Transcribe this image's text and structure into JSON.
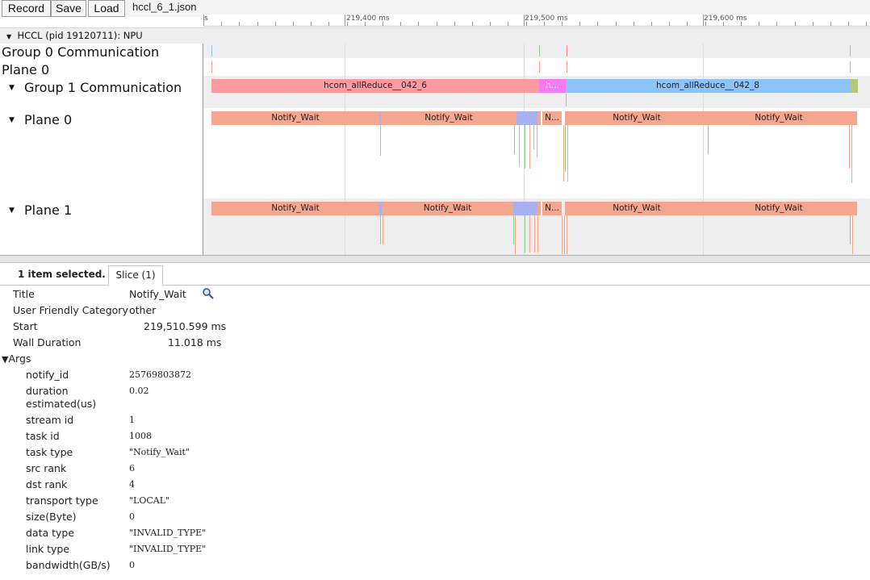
{
  "toolbar": {
    "record_label": "Record",
    "save_label": "Save",
    "load_label": "Load",
    "filename": "hccl_6_1.json"
  },
  "ruler": {
    "left_fragment": "s",
    "ticks": [
      "219,400 ms",
      "219,500 ms",
      "219,600 ms"
    ]
  },
  "process": {
    "label": "HCCL (pid 19120711): NPU"
  },
  "tracks": {
    "group0": "Group 0 Communication",
    "plane0_top": "Plane 0",
    "group1": "Group 1 Communication",
    "plane0": "Plane 0",
    "plane1": "Plane 1"
  },
  "slices": {
    "allreduce6": "hcom_allReduce__042_6",
    "h_short": "h...",
    "allreduce8": "hcom_allReduce__042_8",
    "nw": "Notify_Wait",
    "n_short": "N..."
  },
  "colors": {
    "pink": "#ff9aa2",
    "magenta": "#f77cf2",
    "blue": "#8ec3f7",
    "salmon": "#f5a68f",
    "lavender": "#a8b0f0",
    "olive": "#b5c77a"
  },
  "details": {
    "selection_text": "1 item selected.",
    "tab_label": "Slice (1)",
    "title_key": "Title",
    "title_val": "Notify_Wait",
    "category_key": "User Friendly Category",
    "category_val": "other",
    "start_key": "Start",
    "start_val": "219,510.599 ms",
    "duration_key": "Wall Duration",
    "duration_val": "11.018 ms",
    "args_label": "Args",
    "args": [
      {
        "k": "notify_id",
        "v": "25769803872"
      },
      {
        "k": "duration\nestimated(us)",
        "v": "0.02"
      },
      {
        "k": "stream id",
        "v": "1"
      },
      {
        "k": "task id",
        "v": "1008"
      },
      {
        "k": "task type",
        "v": "\"Notify_Wait\""
      },
      {
        "k": "src rank",
        "v": "6"
      },
      {
        "k": "dst rank",
        "v": "4"
      },
      {
        "k": "transport type",
        "v": "\"LOCAL\""
      },
      {
        "k": "size(Byte)",
        "v": "0"
      },
      {
        "k": "data type",
        "v": "\"INVALID_TYPE\""
      },
      {
        "k": "link type",
        "v": "\"INVALID_TYPE\""
      },
      {
        "k": "bandwidth(GB/s)",
        "v": "0"
      }
    ]
  }
}
